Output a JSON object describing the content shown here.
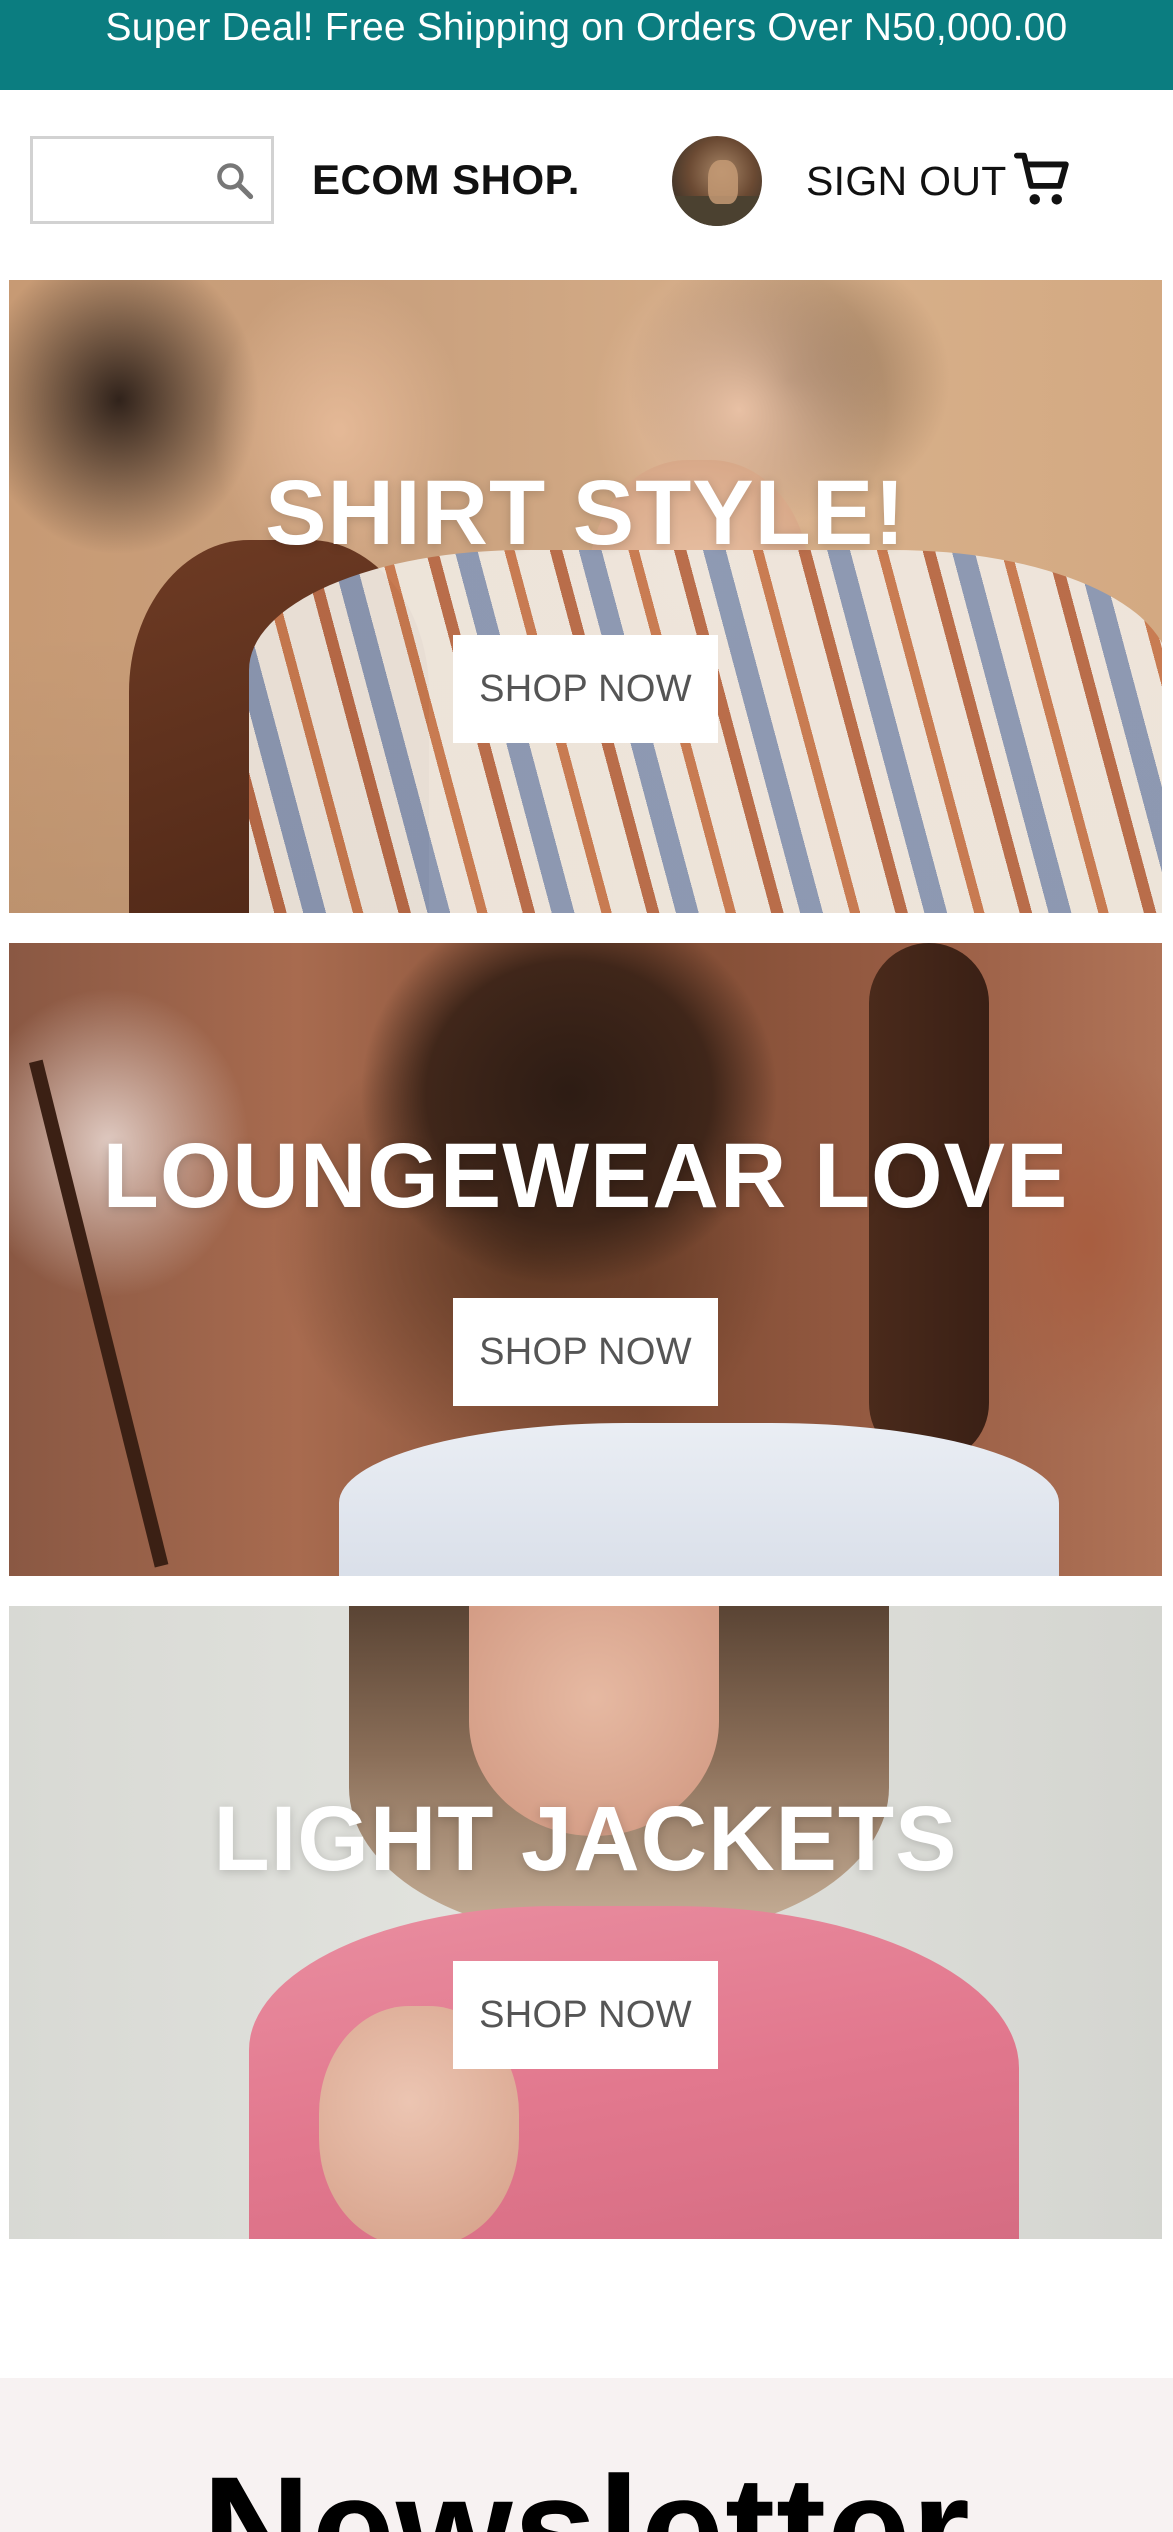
{
  "promo": {
    "text": "Super Deal! Free Shipping on Orders Over N50,000.00",
    "background": "#0b7d80"
  },
  "header": {
    "search": {
      "value": "",
      "placeholder": "",
      "icon": "search-icon"
    },
    "brand": "ECOM SHOP.",
    "avatar": "avatar",
    "sign_out_label": "SIGN OUT",
    "cart_icon": "cart-icon"
  },
  "tiles": [
    {
      "title": "SHIRT STYLE!",
      "button": "SHOP NOW"
    },
    {
      "title": "LOUNGEWEAR LOVE",
      "button": "SHOP NOW"
    },
    {
      "title": "LIGHT JACKETS",
      "button": "SHOP NOW"
    }
  ],
  "newsletter": {
    "title": "Newsletter"
  }
}
